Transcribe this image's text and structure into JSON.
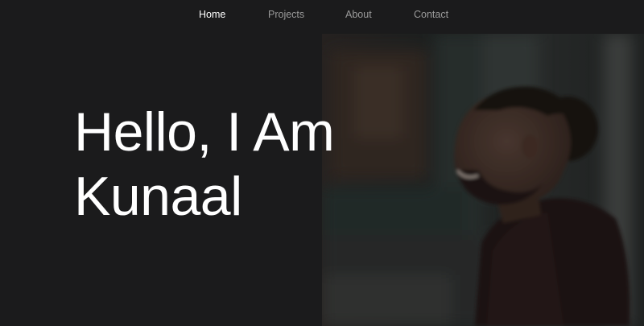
{
  "nav": {
    "items": [
      {
        "label": "Home",
        "active": true
      },
      {
        "label": "Projects",
        "active": false
      },
      {
        "label": "About",
        "active": false
      },
      {
        "label": "Contact",
        "active": false
      }
    ]
  },
  "hero": {
    "line1": "Hello, I Am",
    "line2": "Kunaal"
  },
  "colors": {
    "background": "#1b1b1c",
    "active_link": "#ffffff",
    "inactive_link": "#9a9a9a",
    "heading": "#ffffff"
  }
}
